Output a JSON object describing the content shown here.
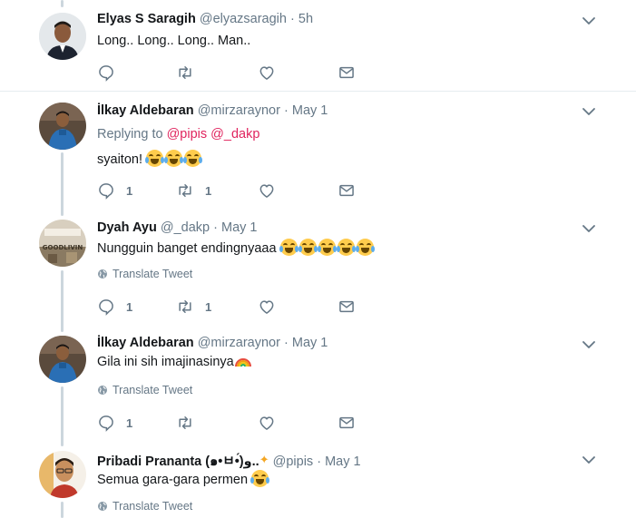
{
  "colors": {
    "name": "#14171a",
    "meta": "#657786",
    "mention": "#e0245e",
    "line": "#ccd6dd",
    "divider": "#e6ecf0"
  },
  "tweets": [
    {
      "name": "Elyas S Saragih",
      "handle": "@elyazsaragih",
      "dot": "·",
      "time": "5h",
      "text": "Long.. Long.. Long.. Man..",
      "reply_count": "",
      "retweet_count": ""
    },
    {
      "name": "İlkay Aldebaran",
      "handle": "@mirzaraynor",
      "dot": "·",
      "time": "May 1",
      "replying_label": "Replying to",
      "replying_mentions": [
        "@pipis",
        "@_dakp"
      ],
      "text": "syaiton!",
      "emoji_count": 3,
      "reply_count": "1",
      "retweet_count": "1"
    },
    {
      "name": "Dyah Ayu",
      "handle": "@_dakp",
      "dot": "·",
      "time": "May 1",
      "text": "Nungguin banget endingnyaaa",
      "emoji_count": 5,
      "translate": "Translate Tweet",
      "reply_count": "1",
      "retweet_count": "1"
    },
    {
      "name": "İlkay Aldebaran",
      "handle": "@mirzaraynor",
      "dot": "·",
      "time": "May 1",
      "text": "Gila ini sih imajinasinya",
      "translate": "Translate Tweet",
      "reply_count": "1",
      "retweet_count": ""
    },
    {
      "name": "Pribadi Prananta (๑•ㅂ•́)و",
      "name_trail": "..",
      "handle": "@pipis",
      "dot": "·",
      "time": "May 1",
      "text": "Semua gara-gara permen",
      "emoji_count": 1,
      "translate": "Translate Tweet"
    }
  ],
  "icons": [
    "reply-icon",
    "retweet-icon",
    "like-icon",
    "direct-message-icon",
    "chevron-down-icon",
    "globe-icon"
  ]
}
